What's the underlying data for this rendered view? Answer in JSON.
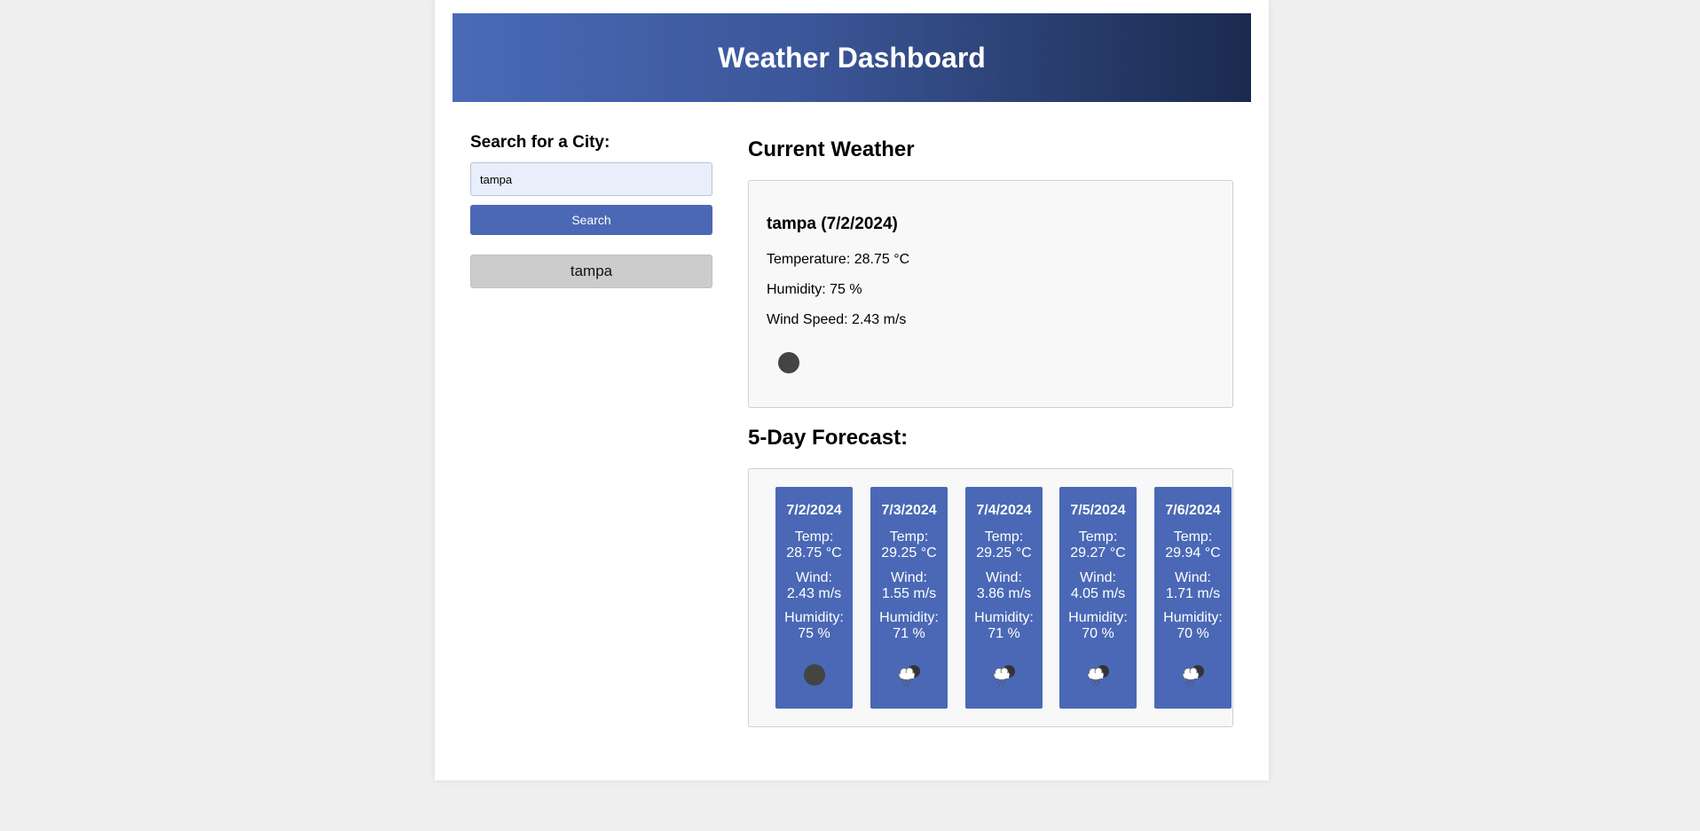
{
  "header": {
    "title": "Weather Dashboard"
  },
  "search": {
    "label": "Search for a City:",
    "value": "tampa",
    "button_label": "Search",
    "history": [
      "tampa"
    ]
  },
  "current": {
    "section_title": "Current Weather",
    "city_date": "tampa (7/2/2024)",
    "temperature": "Temperature: 28.75 °C",
    "humidity": "Humidity: 75 %",
    "wind": "Wind Speed: 2.43 m/s",
    "icon": "dark-circle-icon"
  },
  "forecast": {
    "section_title": "5-Day Forecast:",
    "days": [
      {
        "date": "7/2/2024",
        "temp_label": "Temp:",
        "temp": "28.75 °C",
        "wind_label": "Wind:",
        "wind": "2.43 m/s",
        "humidity_label": "Humidity:",
        "humidity": "75 %",
        "icon": "dark-circle-icon"
      },
      {
        "date": "7/3/2024",
        "temp_label": "Temp:",
        "temp": "29.25 °C",
        "wind_label": "Wind:",
        "wind": "1.55 m/s",
        "humidity_label": "Humidity:",
        "humidity": "71 %",
        "icon": "rain-cloud-night-icon"
      },
      {
        "date": "7/4/2024",
        "temp_label": "Temp:",
        "temp": "29.25 °C",
        "wind_label": "Wind:",
        "wind": "3.86 m/s",
        "humidity_label": "Humidity:",
        "humidity": "71 %",
        "icon": "rain-cloud-night-icon"
      },
      {
        "date": "7/5/2024",
        "temp_label": "Temp:",
        "temp": "29.27 °C",
        "wind_label": "Wind:",
        "wind": "4.05 m/s",
        "humidity_label": "Humidity:",
        "humidity": "70 %",
        "icon": "rain-cloud-night-icon"
      },
      {
        "date": "7/6/2024",
        "temp_label": "Temp:",
        "temp": "29.94 °C",
        "wind_label": "Wind:",
        "wind": "1.71 m/s",
        "humidity_label": "Humidity:",
        "humidity": "70 %",
        "icon": "rain-cloud-night-icon"
      }
    ]
  },
  "colors": {
    "primary": "#4a68b5",
    "header_gradient_start": "#4a6ab8",
    "header_gradient_end": "#1b2a4e",
    "history_button": "#cccccc",
    "input_background": "#e8effb",
    "page_background": "#efefef"
  }
}
